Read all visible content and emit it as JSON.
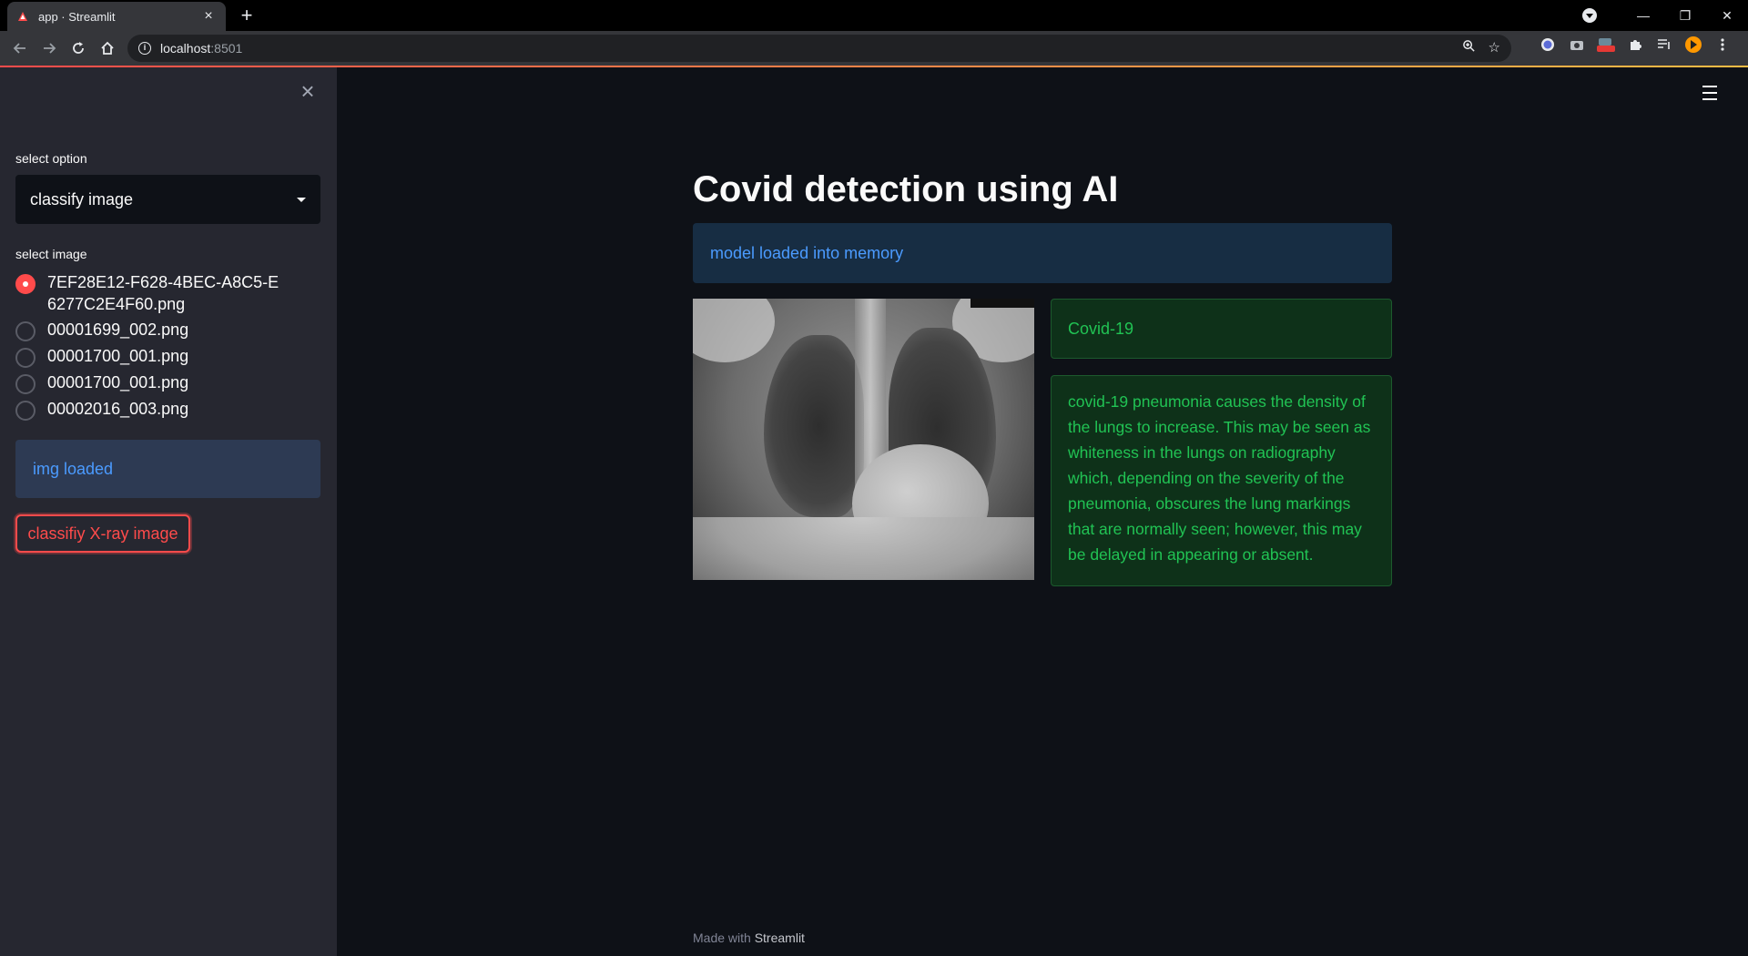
{
  "browser": {
    "tab_title": "app · Streamlit",
    "url_host": "localhost",
    "url_port": ":8501"
  },
  "sidebar": {
    "select_label": "select option",
    "select_value": "classify image",
    "image_label": "select image",
    "images": [
      {
        "name": "7EF28E12-F628-4BEC-A8C5-E6277C2E4F60.png",
        "checked": true
      },
      {
        "name": "00001699_002.png",
        "checked": false
      },
      {
        "name": "00001700_001.png",
        "checked": false
      },
      {
        "name": "00001700_001.png",
        "checked": false
      },
      {
        "name": "00002016_003.png",
        "checked": false
      }
    ],
    "info_text": "img loaded",
    "button_label": "classifiy X-ray image"
  },
  "main": {
    "title": "Covid detection using AI",
    "model_info": "model loaded into memory",
    "result": "Covid-19",
    "description": "covid-19 pneumonia causes the density of the lungs to increase. This may be seen as whiteness in the lungs on radiography which, depending on the severity of the pneumonia, obscures the lung markings that are normally seen; however, this may be delayed in appearing or absent."
  },
  "footer": {
    "prefix": "Made with ",
    "link": "Streamlit"
  },
  "colors": {
    "accent": "#ff4b4b",
    "info_text": "#4b9bff",
    "success_text": "#21c354",
    "background": "#0e1117",
    "sidebar_bg": "#262730"
  }
}
